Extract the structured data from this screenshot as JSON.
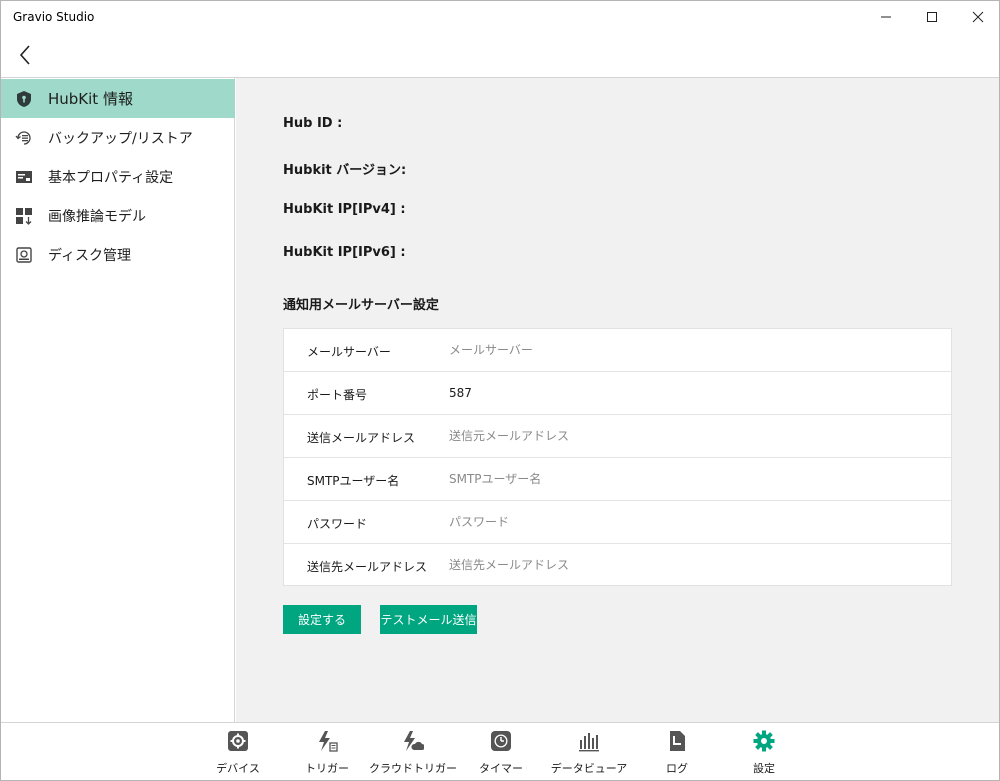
{
  "window": {
    "title": "Gravio Studio",
    "minimize_label": "—",
    "maximize_label": "☐",
    "close_label": "✕"
  },
  "colors": {
    "accent": "#00a680",
    "sidebar_active": "#9ed9c9",
    "main_bg": "#f1f1f1"
  },
  "sidebar": {
    "items": [
      {
        "label": "HubKit 情報",
        "icon": "shield-icon",
        "active": true
      },
      {
        "label": "バックアップ/リストア",
        "icon": "backup-restore-icon",
        "active": false
      },
      {
        "label": "基本プロパティ設定",
        "icon": "property-card-icon",
        "active": false
      },
      {
        "label": "画像推論モデル",
        "icon": "model-download-icon",
        "active": false
      },
      {
        "label": "ディスク管理",
        "icon": "disk-icon",
        "active": false
      }
    ]
  },
  "info": {
    "hub_id_label": "Hub ID :",
    "version_label": "Hubkit バージョン:",
    "ipv4_label": "HubKit IP[IPv4] :",
    "ipv6_label": "HubKit IP[IPv6] :"
  },
  "mail": {
    "section_title": "通知用メールサーバー設定",
    "rows": [
      {
        "label": "メールサーバー",
        "value": "",
        "placeholder": "メールサーバー"
      },
      {
        "label": "ポート番号",
        "value": "587",
        "placeholder": ""
      },
      {
        "label": "送信メールアドレス",
        "value": "",
        "placeholder": "送信元メールアドレス"
      },
      {
        "label": "SMTPユーザー名",
        "value": "",
        "placeholder": "SMTPユーザー名"
      },
      {
        "label": "パスワード",
        "value": "",
        "placeholder": "パスワード"
      },
      {
        "label": "送信先メールアドレス",
        "value": "",
        "placeholder": "送信先メールアドレス"
      }
    ],
    "save_button": "設定する",
    "test_button": "テストメール送信"
  },
  "bottomnav": {
    "items": [
      {
        "label": "デバイス",
        "icon": "device-gear-icon",
        "active": false
      },
      {
        "label": "トリガー",
        "icon": "trigger-icon",
        "active": false
      },
      {
        "label": "クラウドトリガー",
        "icon": "cloud-trigger-icon",
        "active": false
      },
      {
        "label": "タイマー",
        "icon": "timer-clock-icon",
        "active": false
      },
      {
        "label": "データビューア",
        "icon": "bar-chart-icon",
        "active": false
      },
      {
        "label": "ログ",
        "icon": "log-document-icon",
        "active": false
      },
      {
        "label": "設定",
        "icon": "settings-gear-icon",
        "active": true
      }
    ]
  }
}
